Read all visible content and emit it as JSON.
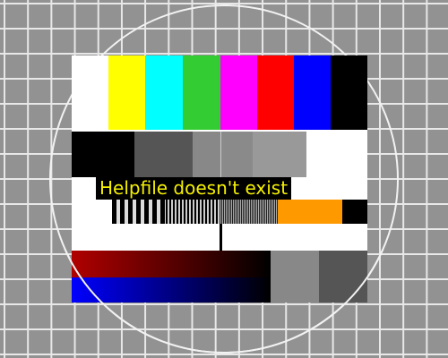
{
  "message": "Helpfile doesn't exist",
  "color_bars": [
    "#ffffff",
    "#ffff00",
    "#00ffff",
    "#33cc33",
    "#ff00ff",
    "#ff0000",
    "#0000ff",
    "#000000"
  ],
  "gray_row": [
    "#000000",
    "#555555",
    "#888888",
    "#8a8a8a",
    "#999999",
    "#ffffff"
  ],
  "accent": "#ff9900"
}
